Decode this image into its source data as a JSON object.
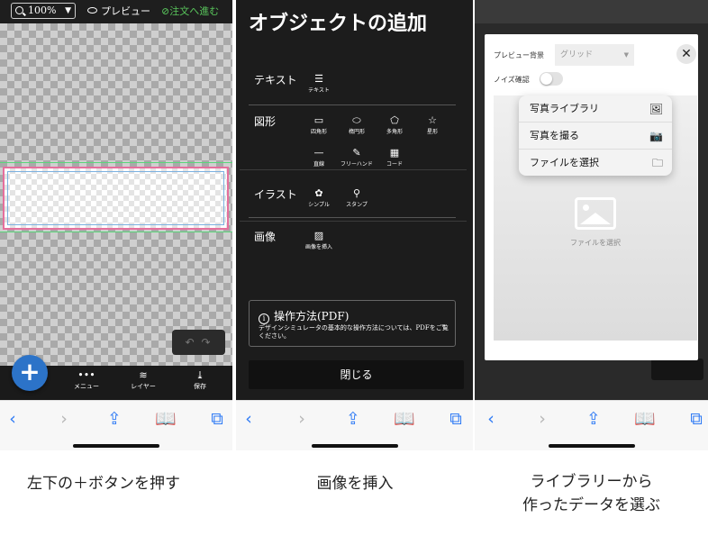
{
  "panel1": {
    "zoom": "100%",
    "preview": "プレビュー",
    "order": "注文へ進む",
    "add_button": "+",
    "toolbar": [
      {
        "label": "メニュー",
        "icon": "dots-icon"
      },
      {
        "label": "レイヤー",
        "icon": "layers-icon"
      },
      {
        "label": "保存",
        "icon": "download-icon"
      }
    ],
    "caption": "左下の＋ボタンを押す"
  },
  "panel2": {
    "title": "オブジェクトの追加",
    "sections": {
      "text": {
        "label": "テキスト",
        "items": [
          "テキスト"
        ]
      },
      "shapes": {
        "label": "図形",
        "items": [
          "四角形",
          "楕円形",
          "多角形",
          "星形",
          "直線",
          "フリーハンド",
          "コード"
        ]
      },
      "illust": {
        "label": "イラスト",
        "items": [
          "シンプル",
          "スタンプ"
        ]
      },
      "image": {
        "label": "画像",
        "items": [
          "画像を挿入"
        ]
      }
    },
    "help_title": "操作方法(PDF)",
    "help_body": "デザインシミュレータの基本的な操作方法については、PDFをご覧ください。",
    "close": "閉じる",
    "caption": "画像を挿入"
  },
  "panel3": {
    "bg_label": "プレビュー背景",
    "bg_value": "グリッド",
    "noise_label": "ノイズ確認",
    "menu": [
      {
        "label": "写真ライブラリ",
        "icon": "photo-library-icon"
      },
      {
        "label": "写真を撮る",
        "icon": "camera-icon"
      },
      {
        "label": "ファイルを選択",
        "icon": "folder-icon"
      }
    ],
    "upload_text": "ファイルを選択",
    "caption_line1": "ライブラリーから",
    "caption_line2": "作ったデータを選ぶ"
  },
  "colors": {
    "accent": "#2c73c8",
    "order_green": "#58c35b",
    "safari_blue": "#2f7bf5"
  }
}
